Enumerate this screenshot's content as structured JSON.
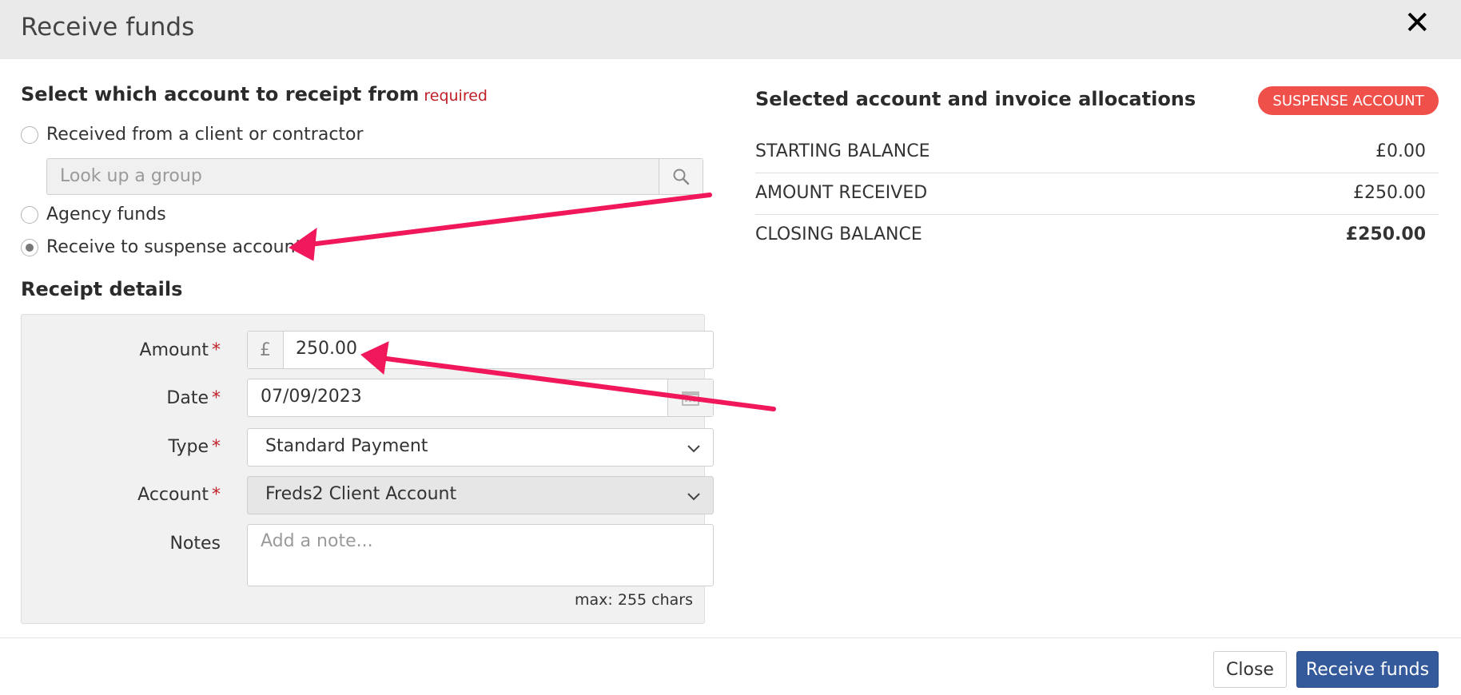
{
  "dialog": {
    "title": "Receive funds"
  },
  "source": {
    "heading": "Select which account to receipt from",
    "required_label": "required",
    "options": [
      {
        "label": "Received from a client or contractor",
        "checked": false
      },
      {
        "label": "Agency funds",
        "checked": false
      },
      {
        "label": "Receive to suspense account",
        "checked": true
      }
    ],
    "lookup_placeholder": "Look up a group"
  },
  "receipt": {
    "heading": "Receipt details",
    "amount_label": "Amount",
    "currency_symbol": "£",
    "amount_value": "250.00",
    "date_label": "Date",
    "date_value": "07/09/2023",
    "type_label": "Type",
    "type_value": "Standard Payment",
    "account_label": "Account",
    "account_value": "Freds2 Client Account",
    "notes_label": "Notes",
    "notes_placeholder": "Add a note...",
    "notes_hint": "max: 255 chars",
    "required_mark": "*"
  },
  "summary": {
    "heading": "Selected account and invoice allocations",
    "badge": "SUSPENSE ACCOUNT",
    "rows": [
      {
        "label": "STARTING BALANCE",
        "value": "£0.00"
      },
      {
        "label": "AMOUNT RECEIVED",
        "value": "£250.00"
      },
      {
        "label": "CLOSING BALANCE",
        "value": "£250.00"
      }
    ]
  },
  "footer": {
    "close_label": "Close",
    "submit_label": "Receive funds"
  },
  "colors": {
    "accent": "#345a9c",
    "badge": "#f0504a",
    "required": "#c0202a",
    "annotation_arrow": "#f0185a"
  }
}
